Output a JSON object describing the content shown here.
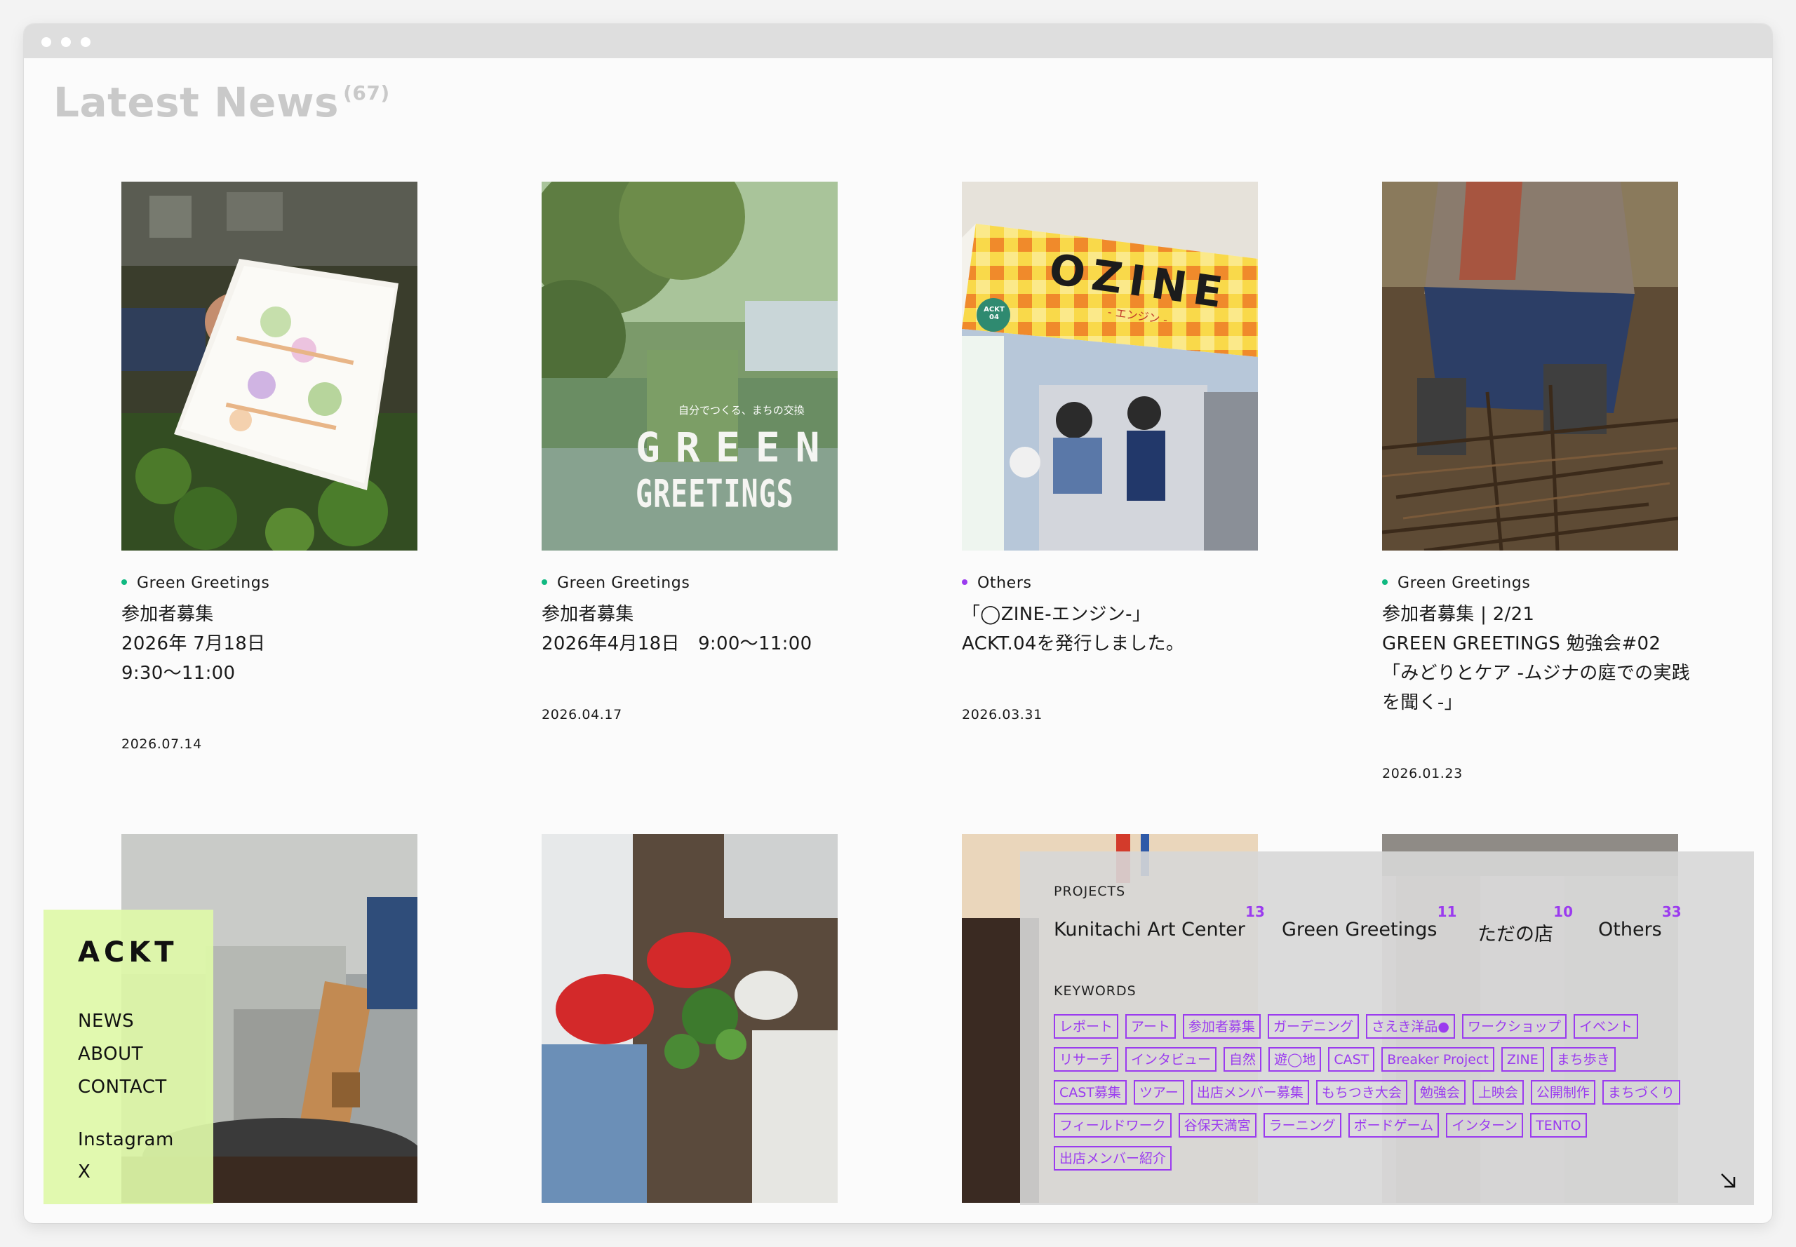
{
  "page": {
    "title": "Latest News",
    "count": "(67)"
  },
  "colors": {
    "green_greetings": "#10b981",
    "others": "#9b3bef",
    "accent_purple": "#9b3bef",
    "nav_bg": "#def8a8"
  },
  "news": [
    {
      "category": "Green Greetings",
      "category_color": "#10b981",
      "title_lines": [
        "参加者募集",
        "2026年 7月18日",
        "9:30〜11:00"
      ],
      "date": "2026.07.14"
    },
    {
      "category": "Green Greetings",
      "category_color": "#10b981",
      "title_lines": [
        "参加者募集",
        "2026年4月18日　9:00〜11:00"
      ],
      "date": "2026.04.17"
    },
    {
      "category": "Others",
      "category_color": "#9b3bef",
      "title_lines": [
        "「◯ZINE-エンジン-」",
        "ACKT.04を発行しました。"
      ],
      "date": "2026.03.31"
    },
    {
      "category": "Green Greetings",
      "category_color": "#10b981",
      "title_lines": [
        "参加者募集 | 2/21",
        "GREEN GREETINGS 勉強会#02",
        "「みどりとケア -ムジナの庭での実践",
        "を聞く-」"
      ],
      "date": "2026.01.23"
    }
  ],
  "thumb_text": {
    "green_greetings_sub": "自分でつくる、まちの交換",
    "green_greetings_line1": "GREEN",
    "green_greetings_line2": "GREETINGS",
    "ozine_title": "OZINE",
    "ozine_sub": "- エンジン -",
    "ozine_badge": "ACKT 04"
  },
  "nav": {
    "logo": "ACKT",
    "news": "NEWS",
    "about": "ABOUT",
    "contact": "CONTACT",
    "instagram": "Instagram",
    "x": "X"
  },
  "filters": {
    "projects_label": "PROJECTS",
    "keywords_label": "KEYWORDS",
    "projects": [
      {
        "name": "Kunitachi Art Center",
        "count": "13"
      },
      {
        "name": "Green Greetings",
        "count": "11"
      },
      {
        "name": "ただの店",
        "count": "10"
      },
      {
        "name": "Others",
        "count": "33"
      }
    ],
    "keyword_rows": [
      [
        "レポート",
        "アート",
        "参加者募集",
        "ガーデニング",
        "さえき洋品●",
        "ワークショップ",
        "イベント"
      ],
      [
        "リサーチ",
        "インタビュー",
        "自然",
        "遊◯地",
        "CAST",
        "Breaker Project",
        "ZINE",
        "まち歩き"
      ],
      [
        "CAST募集",
        "ツアー",
        "出店メンバー募集",
        "もちつき大会",
        "勉強会",
        "上映会",
        "公開制作",
        "まちづくり"
      ],
      [
        "フィールドワーク",
        "谷保天満宮",
        "ラーニング",
        "ボードゲーム",
        "インターン",
        "TENTO"
      ],
      [
        "出店メンバー紹介"
      ]
    ]
  }
}
